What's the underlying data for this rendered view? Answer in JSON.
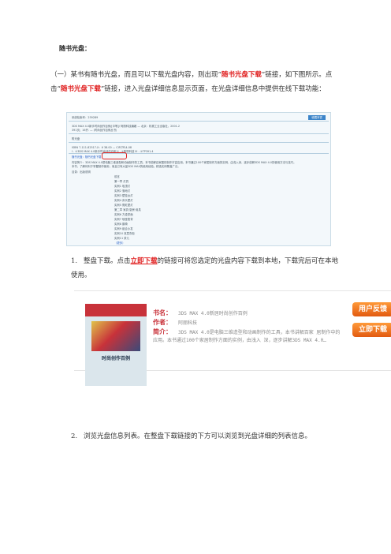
{
  "doc": {
    "title": "随书光盘：",
    "intro_pre": "（一）某书有随书光盘，而且可以下载光盘内容，则出现“",
    "intro_highlight": "随书光盘下载",
    "intro_post": "”链接，如下图所示。点击“",
    "intro_highlight2": "随书光盘下载",
    "intro_post2": "”链接，进入光盘详细信息显示页面，在光盘详细信息中提供在线下载功能：",
    "step1_num": "1.",
    "step1_pre": "整盘下载。点击",
    "step1_link": "立即下载",
    "step1_post": "的链接可将您选定的光盘内容下载到本地，下载完后可在本地使用。",
    "step2_num": "2.",
    "step2_text": "浏览光盘信息列表。在整盘下载链接的下方可以浏览到光盘详细的列表信息。"
  },
  "screenshot1": {
    "fav_button": "收藏本書",
    "lines": [
      "系统检索号：239289",
      "3DS MAX 4.0新手时尚创作百例/[中等]/ 阿丽科技编著 — 北京：机械工业出版社，2001.2",
      "391页；16开. — (时尚创作百例丛书)",
      "附光盘",
      "ISBN 7-111-82517-X：¥ 38.00 — CIP(TP)4-08",
      "I . ①3DS MAX 4.0新手时尚创作百例  II . ①阿丽科技  III . ①TP391.4",
      "随书光盘：随书光盘下载",
      "内容简介：3DS MAX 4.0是电脑三维造型和动画制作的工具，本书讲解百家图形制作丰富应用。本书通过100个家居制作方面的实例，由浅入深，逐步讲解3DS MAX 4.0的使用方法与技巧。",
      "本书，了解何利于掌握制作使用，而且已有大量3DS MAX的使用经验。精选实例覆盖广泛。",
      "目录：出版说明"
    ],
    "toc": [
      "前言",
      "第一章 灯具",
      "实例1 吸顶灯",
      "实例2 落地灯",
      "实例3 壁挂台灯",
      "实例4 床头壁灯",
      "实例5 霓虹壁灯",
      "第二章 家具·厨房·用具",
      "实例6 方桌漆面",
      "实例7 软座靠背",
      "实例8 藤椅",
      "实例9 组合沙发",
      "实例10 双层衣柜",
      "实例11 茶几",
      "（更多）"
    ]
  },
  "screenshot2": {
    "cover_label": "时尚创作百例",
    "book_label": "书名：",
    "book_value": "3DS MAX 4.0新居时尚创作百例",
    "author_label": "作者：",
    "author_value": "阿丽科技",
    "summary_label": "简介：",
    "summary_value": "3DS MAX 4.0是电脑三维造型和动画制作的工具，本书讲解百家 居制作中的应用。本书通过100个家居制作方面的实例，由浅入 深，逐步讲解3DS MAX 4.0…",
    "feedback_button": "用户反馈",
    "download_button": "立即下载"
  }
}
